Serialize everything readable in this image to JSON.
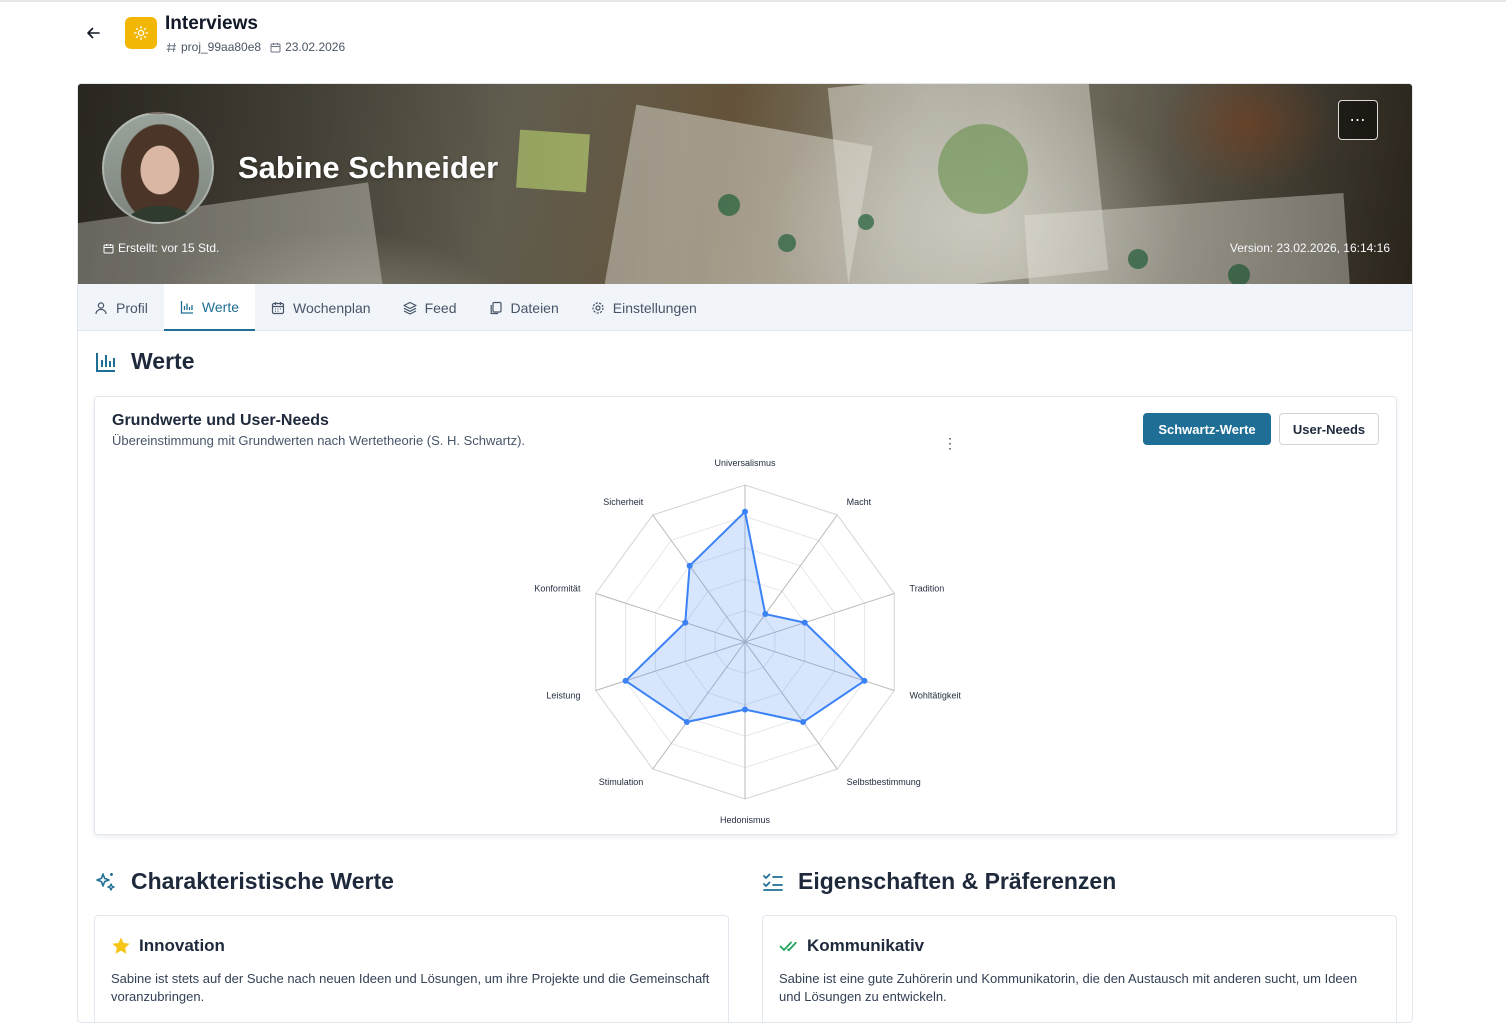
{
  "header": {
    "title": "Interviews",
    "project_id": "proj_99aa80e8",
    "date": "23.02.2026",
    "icon": "sun-icon"
  },
  "hero": {
    "name": "Sabine Schneider",
    "created": "Erstellt: vor 15 Std.",
    "version": "Version: 23.02.2026, 16:14:16",
    "more_label": "⋯"
  },
  "tabs": [
    {
      "label": "Profil",
      "icon": "user-icon"
    },
    {
      "label": "Werte",
      "icon": "bar-chart-icon",
      "active": true
    },
    {
      "label": "Wochenplan",
      "icon": "calendar-icon"
    },
    {
      "label": "Feed",
      "icon": "layers-icon"
    },
    {
      "label": "Dateien",
      "icon": "files-icon"
    },
    {
      "label": "Einstellungen",
      "icon": "gear-icon"
    }
  ],
  "werte": {
    "section_title": "Werte",
    "chart_title": "Grundwerte und User-Needs",
    "chart_subtitle": "Übereinstimmung mit Grundwerten nach Wertetheorie (S. H. Schwartz).",
    "btn_schwartz": "Schwartz-Werte",
    "btn_userneeds": "User-Needs",
    "kebab": "⋮"
  },
  "chart_data": {
    "type": "radar",
    "categories": [
      "Universalismus",
      "Macht",
      "Tradition",
      "Wohltätigkeit",
      "Selbstbestimmung",
      "Hedonismus",
      "Stimulation",
      "Leistung",
      "Konformität",
      "Sicherheit"
    ],
    "values": [
      83,
      22,
      40,
      80,
      63,
      43,
      63,
      80,
      40,
      60
    ],
    "ylim": [
      0,
      100
    ],
    "rings": 5,
    "color": "#3b82f6",
    "fill": "rgba(59,130,246,0.2)"
  },
  "charakteristische": {
    "section_title": "Charakteristische Werte",
    "card_title": "Innovation",
    "card_text": "Sabine ist stets auf der Suche nach neuen Ideen und Lösungen, um ihre Projekte und die Gemeinschaft voranzubringen."
  },
  "eigenschaften": {
    "section_title": "Eigenschaften & Präferenzen",
    "card_title": "Kommunikativ",
    "card_text": "Sabine ist eine gute Zuhörerin und Kommunikatorin, die den Austausch mit anderen sucht, um Ideen und Lösungen zu entwickeln."
  }
}
